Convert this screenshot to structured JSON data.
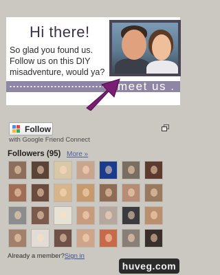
{
  "banner": {
    "greeting": "Hi there!",
    "blurb": "So glad you found us. Follow us on this DIY misadventure, would ya?",
    "meet_label": "meet us ."
  },
  "gadget": {
    "follow_label": "Follow",
    "caption": "with Google Friend Connect",
    "followers_title": "Followers (95)",
    "more_link": "More »",
    "already_member": "Already a member?",
    "sign_in": "Sign in"
  },
  "followers": [
    {
      "color": "#8b6f5c"
    },
    {
      "color": "#5a4438"
    },
    {
      "color": "#d8c8a8"
    },
    {
      "color": "#c9a58d"
    },
    {
      "color": "#1b3c8c"
    },
    {
      "color": "#7a6d61"
    },
    {
      "color": "#5c3a2e"
    },
    {
      "color": "#a06d57"
    },
    {
      "color": "#6b4b3e"
    },
    {
      "color": "#d6b58a"
    },
    {
      "color": "#c79a6e"
    },
    {
      "color": "#8e6b54"
    },
    {
      "color": "#b68c74"
    },
    {
      "color": "#9a7a5e"
    },
    {
      "color": "#8c8c8c"
    },
    {
      "color": "#7b5a4c"
    },
    {
      "color": "#e7e2d6"
    },
    {
      "color": "#c89a7e"
    },
    {
      "color": "#b5a79e"
    },
    {
      "color": "#3b3a3f"
    },
    {
      "color": "#b98f6d"
    },
    {
      "color": "#a2806c"
    },
    {
      "color": "#e1ddd6"
    },
    {
      "color": "#6f5148"
    },
    {
      "color": "#cfa48a"
    },
    {
      "color": "#c76a4a"
    },
    {
      "color": "#8a7f76"
    },
    {
      "color": "#3a2f2b"
    }
  ],
  "watermark": "huveg.com"
}
